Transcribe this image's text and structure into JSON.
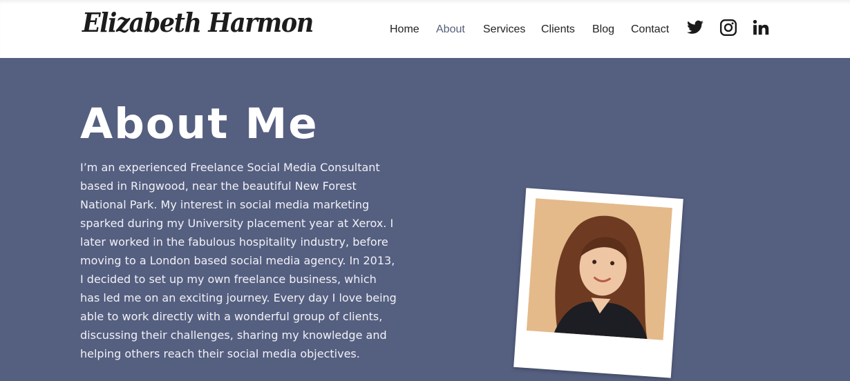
{
  "header": {
    "logo": "Elizabeth Harmon",
    "nav": [
      "Home",
      "About",
      "Services",
      "Clients",
      "Blog",
      "Contact"
    ],
    "active_nav": "About",
    "social": [
      "twitter-icon",
      "instagram-icon",
      "linkedin-icon"
    ]
  },
  "hero": {
    "title": "About Me",
    "bio": "I’m an experienced Freelance Social Media Consultant based in Ringwood, near the beautiful New Forest National Park. My interest in social media marketing sparked during my University placement year at Xerox. I later worked in the fabulous hospitality industry, before moving to a London based social media agency. In 2013, I decided to set up my own freelance business, which has led me on an exciting journey. Every day I love being able to work directly with a wonderful group of clients, discussing their challenges, sharing my knowledge and helping others reach their social media objectives."
  },
  "colors": {
    "hero_background": "#555f80",
    "header_background": "#ffffff",
    "text_on_hero": "#ffffff"
  }
}
